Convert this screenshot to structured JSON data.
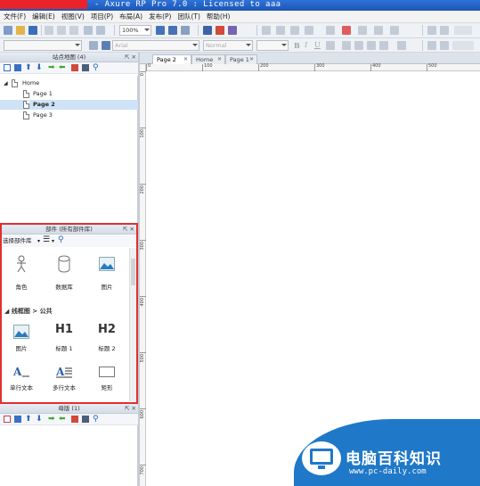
{
  "window": {
    "title": "- Axure RP Pro 7.0 : Licensed to aaa"
  },
  "menu": [
    "文件(F)",
    "编辑(E)",
    "视图(V)",
    "项目(P)",
    "布局(A)",
    "发布(P)",
    "团队(T)",
    "帮助(H)"
  ],
  "toolbar": {
    "zoom": "100%",
    "font": "Arial",
    "font_style": "Normal"
  },
  "sitemap": {
    "title": "站点地图 (4)",
    "root": "Home",
    "pages": [
      "Page 1",
      "Page 2",
      "Page 3"
    ],
    "selected": "Page 2"
  },
  "widgets": {
    "title": "部件 (所有部件库)",
    "library_select": "选择部件库",
    "row1": [
      "角色",
      "数据库",
      "图片"
    ],
    "section": "线框图 > 公共",
    "row2": [
      "图片",
      "标题 1",
      "标题 2"
    ],
    "row2_glyphs": [
      "",
      "H1",
      "H2"
    ],
    "row3": [
      "单行文本",
      "多行文本",
      "矩形"
    ]
  },
  "masters": {
    "title": "母版 (1)"
  },
  "tabs": [
    "Page 2",
    "Home",
    "Page 1"
  ],
  "ruler": {
    "h_labels": [
      "0",
      "100",
      "200",
      "300",
      "400",
      "500"
    ],
    "v_labels": [
      "0",
      "100",
      "200",
      "300",
      "400",
      "500",
      "600",
      "700"
    ]
  },
  "watermark": {
    "title": "电脑百科知识",
    "url": "www.pc-daily.com"
  },
  "colors": {
    "highlight_border": "#e03030",
    "titlebar": "#1c55b5",
    "selection": "#cfe3f6",
    "watermark": "#1f78c8"
  }
}
